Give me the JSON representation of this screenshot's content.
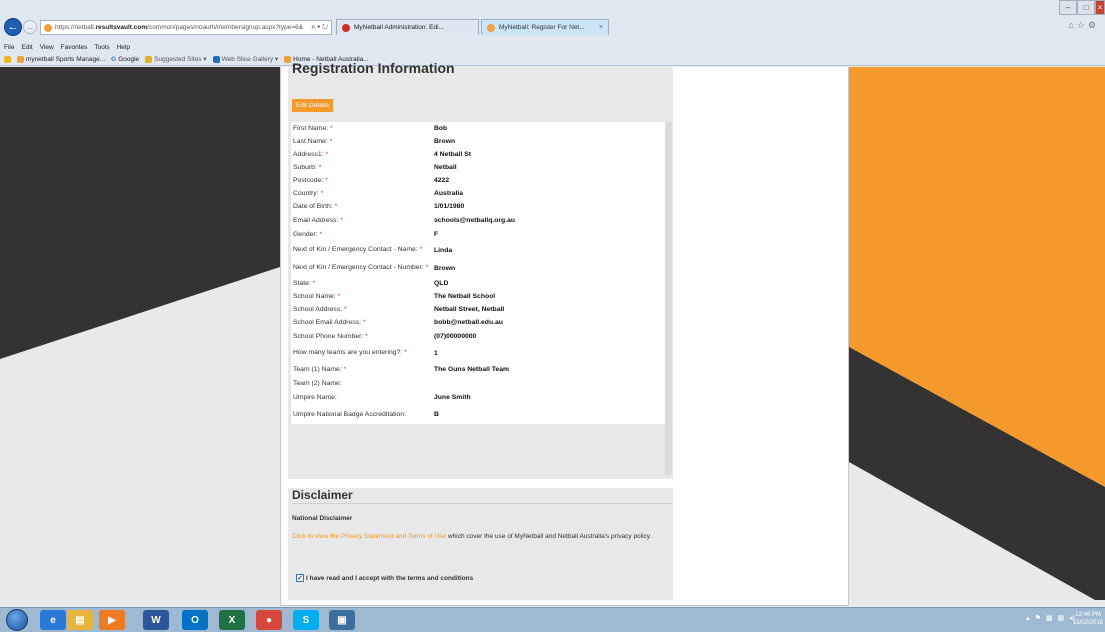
{
  "browser": {
    "url_prefix": "https://netball.",
    "url_domain": "resultsvault.com",
    "url_path": "/common/pages/noauth/membersignup.aspx?type=6&",
    "url_tools": "⌕ ▾ ↻",
    "tabs": [
      {
        "title": "MyNetball Administration: Edi..."
      },
      {
        "title": "MyNetball: Register For Net..."
      }
    ],
    "tab_close": "×",
    "menu": [
      "File",
      "Edit",
      "View",
      "Favorites",
      "Tools",
      "Help"
    ],
    "favorites": [
      {
        "label": "mynetball Sports Manage...",
        "icon": "mynetball-icon"
      },
      {
        "label": "Google",
        "icon": "google-icon"
      },
      {
        "label": "Suggested Sites ▾",
        "icon": "suggested-sites-icon"
      },
      {
        "label": "Web Slice Gallery ▾",
        "icon": "web-slice-icon"
      },
      {
        "label": "Home - Netball Australia...",
        "icon": "netball-home-icon"
      }
    ],
    "google_icon_letter": "G"
  },
  "registration": {
    "heading": "Registration Information",
    "edit_button": "Edit Details",
    "required_marker": "*",
    "fields": [
      {
        "label": "First Name:",
        "value": "Bob",
        "required": true
      },
      {
        "label": "Last Name:",
        "value": "Brown",
        "required": true
      },
      {
        "label": "Address1:",
        "value": "4 Netball St",
        "required": true
      },
      {
        "label": "Suburb:",
        "value": "Netball",
        "required": true
      },
      {
        "label": "Postcode:",
        "value": "4222",
        "required": true
      },
      {
        "label": "Country:",
        "value": "Australia",
        "required": true
      },
      {
        "label": "Date of Birth:",
        "value": "1/01/1980",
        "required": true
      },
      {
        "label": "Email Address:",
        "value": "schools@netballq.org.au",
        "required": true
      },
      {
        "label": "Gender:",
        "value": "F",
        "required": true
      },
      {
        "label": "Next of Kin / Emergency Contact - Name:",
        "value": "Linda",
        "required": true
      },
      {
        "label": "Next of Kin / Emergency Contact - Number:",
        "value": "Brown",
        "required": true
      },
      {
        "label": "State:",
        "value": "QLD",
        "required": true
      },
      {
        "label": "School Name:",
        "value": "The Netball School",
        "required": true
      },
      {
        "label": "School Address:",
        "value": "Netball Street, Netball",
        "required": true
      },
      {
        "label": "School Email Address:",
        "value": "bobb@netball.edu.au",
        "required": true
      },
      {
        "label": "School Phone Number:",
        "value": "(07)00000000",
        "required": true
      },
      {
        "label": "How many teams are you entering?:",
        "value": "1",
        "required": true
      },
      {
        "label": "Team (1) Name:",
        "value": "The Guns Netball Team",
        "required": true
      },
      {
        "label": "Team (2) Name:",
        "value": "",
        "required": false
      },
      {
        "label": "Umpire Name:",
        "value": "June Smith",
        "required": false
      },
      {
        "label": "Umpire National Badge Accreditation:",
        "value": "B",
        "required": false
      }
    ]
  },
  "disclaimer": {
    "heading": "Disclaimer",
    "national_label": "National Disclaimer",
    "link_text": "Click to view the Privacy Statement and Terms of Use",
    "text_rest": " which cover the use of MyNetball and Netball Australia's privacy policy.",
    "accept_label": "I have read and I accept with the terms and conditions",
    "accepted": true
  },
  "taskbar": {
    "apps": [
      {
        "name": "ie-taskbar-icon",
        "glyph": "e",
        "color": "#2a7ad6"
      },
      {
        "name": "explorer-taskbar-icon",
        "glyph": "▤",
        "color": "#e8b53a"
      },
      {
        "name": "media-player-taskbar-icon",
        "glyph": "▶",
        "color": "#f07a1f"
      },
      {
        "name": "word-taskbar-icon",
        "glyph": "W",
        "color": "#2b579a"
      },
      {
        "name": "outlook-taskbar-icon",
        "glyph": "O",
        "color": "#0072c6"
      },
      {
        "name": "excel-taskbar-icon",
        "glyph": "X",
        "color": "#217346"
      },
      {
        "name": "chrome-taskbar-icon",
        "glyph": "●",
        "color": "#d8463a"
      },
      {
        "name": "skype-taskbar-icon",
        "glyph": "S",
        "color": "#00aff0"
      },
      {
        "name": "photos-taskbar-icon",
        "glyph": "▣",
        "color": "#3c6e9e"
      }
    ],
    "tray_icons": [
      "▴",
      "⚑",
      "▩",
      "▦",
      "◂)"
    ],
    "time": "12:46 PM",
    "date": "15/02/2016"
  },
  "colors": {
    "accent_orange": "#f39a2a",
    "background_dark": "#353233",
    "required_red": "#e0301e"
  }
}
